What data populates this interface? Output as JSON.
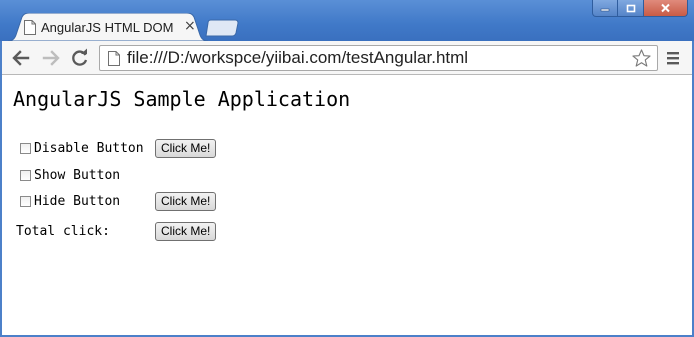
{
  "browser": {
    "tab_title": "AngularJS HTML DOM",
    "tab_close_glyph": "×",
    "url": "file:///D:/workspce/yiibai.com/testAngular.html"
  },
  "page": {
    "heading": "AngularJS Sample Application",
    "disable_label": "Disable Button",
    "show_label": "Show Button",
    "hide_label": "Hide Button",
    "total_label": "Total click:",
    "button_label": "Click Me!",
    "disable_checked": false,
    "show_checked": false,
    "hide_checked": false
  },
  "icons": {
    "back": "back-arrow-icon",
    "forward": "forward-arrow-icon",
    "reload": "reload-icon",
    "page": "page-icon",
    "star": "star-icon",
    "menu": "menu-icon",
    "minimize": "minimize-icon",
    "maximize": "maximize-icon",
    "close": "close-icon"
  },
  "colors": {
    "frame": "#4079c8",
    "toolbar": "#f6f6f6"
  }
}
